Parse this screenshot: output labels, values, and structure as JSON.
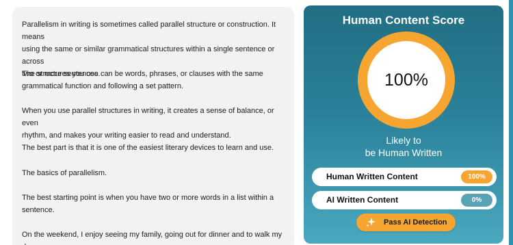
{
  "content": {
    "paragraphs": [
      {
        "lines": [
          "Parallelism in writing is sometimes called parallel structure or construction. It means",
          "using the same or similar grammatical structures within a single sentence or across",
          "two or more sentences."
        ]
      },
      {
        "lines": [
          "The structures you use can be words, phrases, or clauses with the same",
          "grammatical function and following a set pattern."
        ]
      },
      {
        "lines": [
          "When you use parallel structures in writing, it creates a sense of balance, or even",
          "rhythm, and makes your writing easier to read and understand."
        ]
      },
      {
        "lines": [
          "The best part is that it is one of the easiest literary devices to learn and use."
        ]
      },
      {
        "lines": [
          "The basics of parallelism."
        ]
      },
      {
        "lines": [
          "The best starting point is when you have two or more words in a list within a",
          "sentence."
        ]
      },
      {
        "lines": [
          "On the weekend, I enjoy seeing my family, going out for dinner and to walk my dog."
        ]
      }
    ]
  },
  "score": {
    "title": "Human Content Score",
    "value": "100%",
    "verdict_line1": "Likely to",
    "verdict_line2": "be Human Written",
    "human_label": "Human Written Content",
    "human_value": "100%",
    "ai_label": "AI Written Content",
    "ai_value": "0%",
    "button_label": "Pass AI Detection",
    "button_icon": "sparkle-icon"
  },
  "colors": {
    "accent_orange": "#f7a531",
    "panel_teal": "#216e84",
    "ai_pill": "#5aa3b4"
  }
}
